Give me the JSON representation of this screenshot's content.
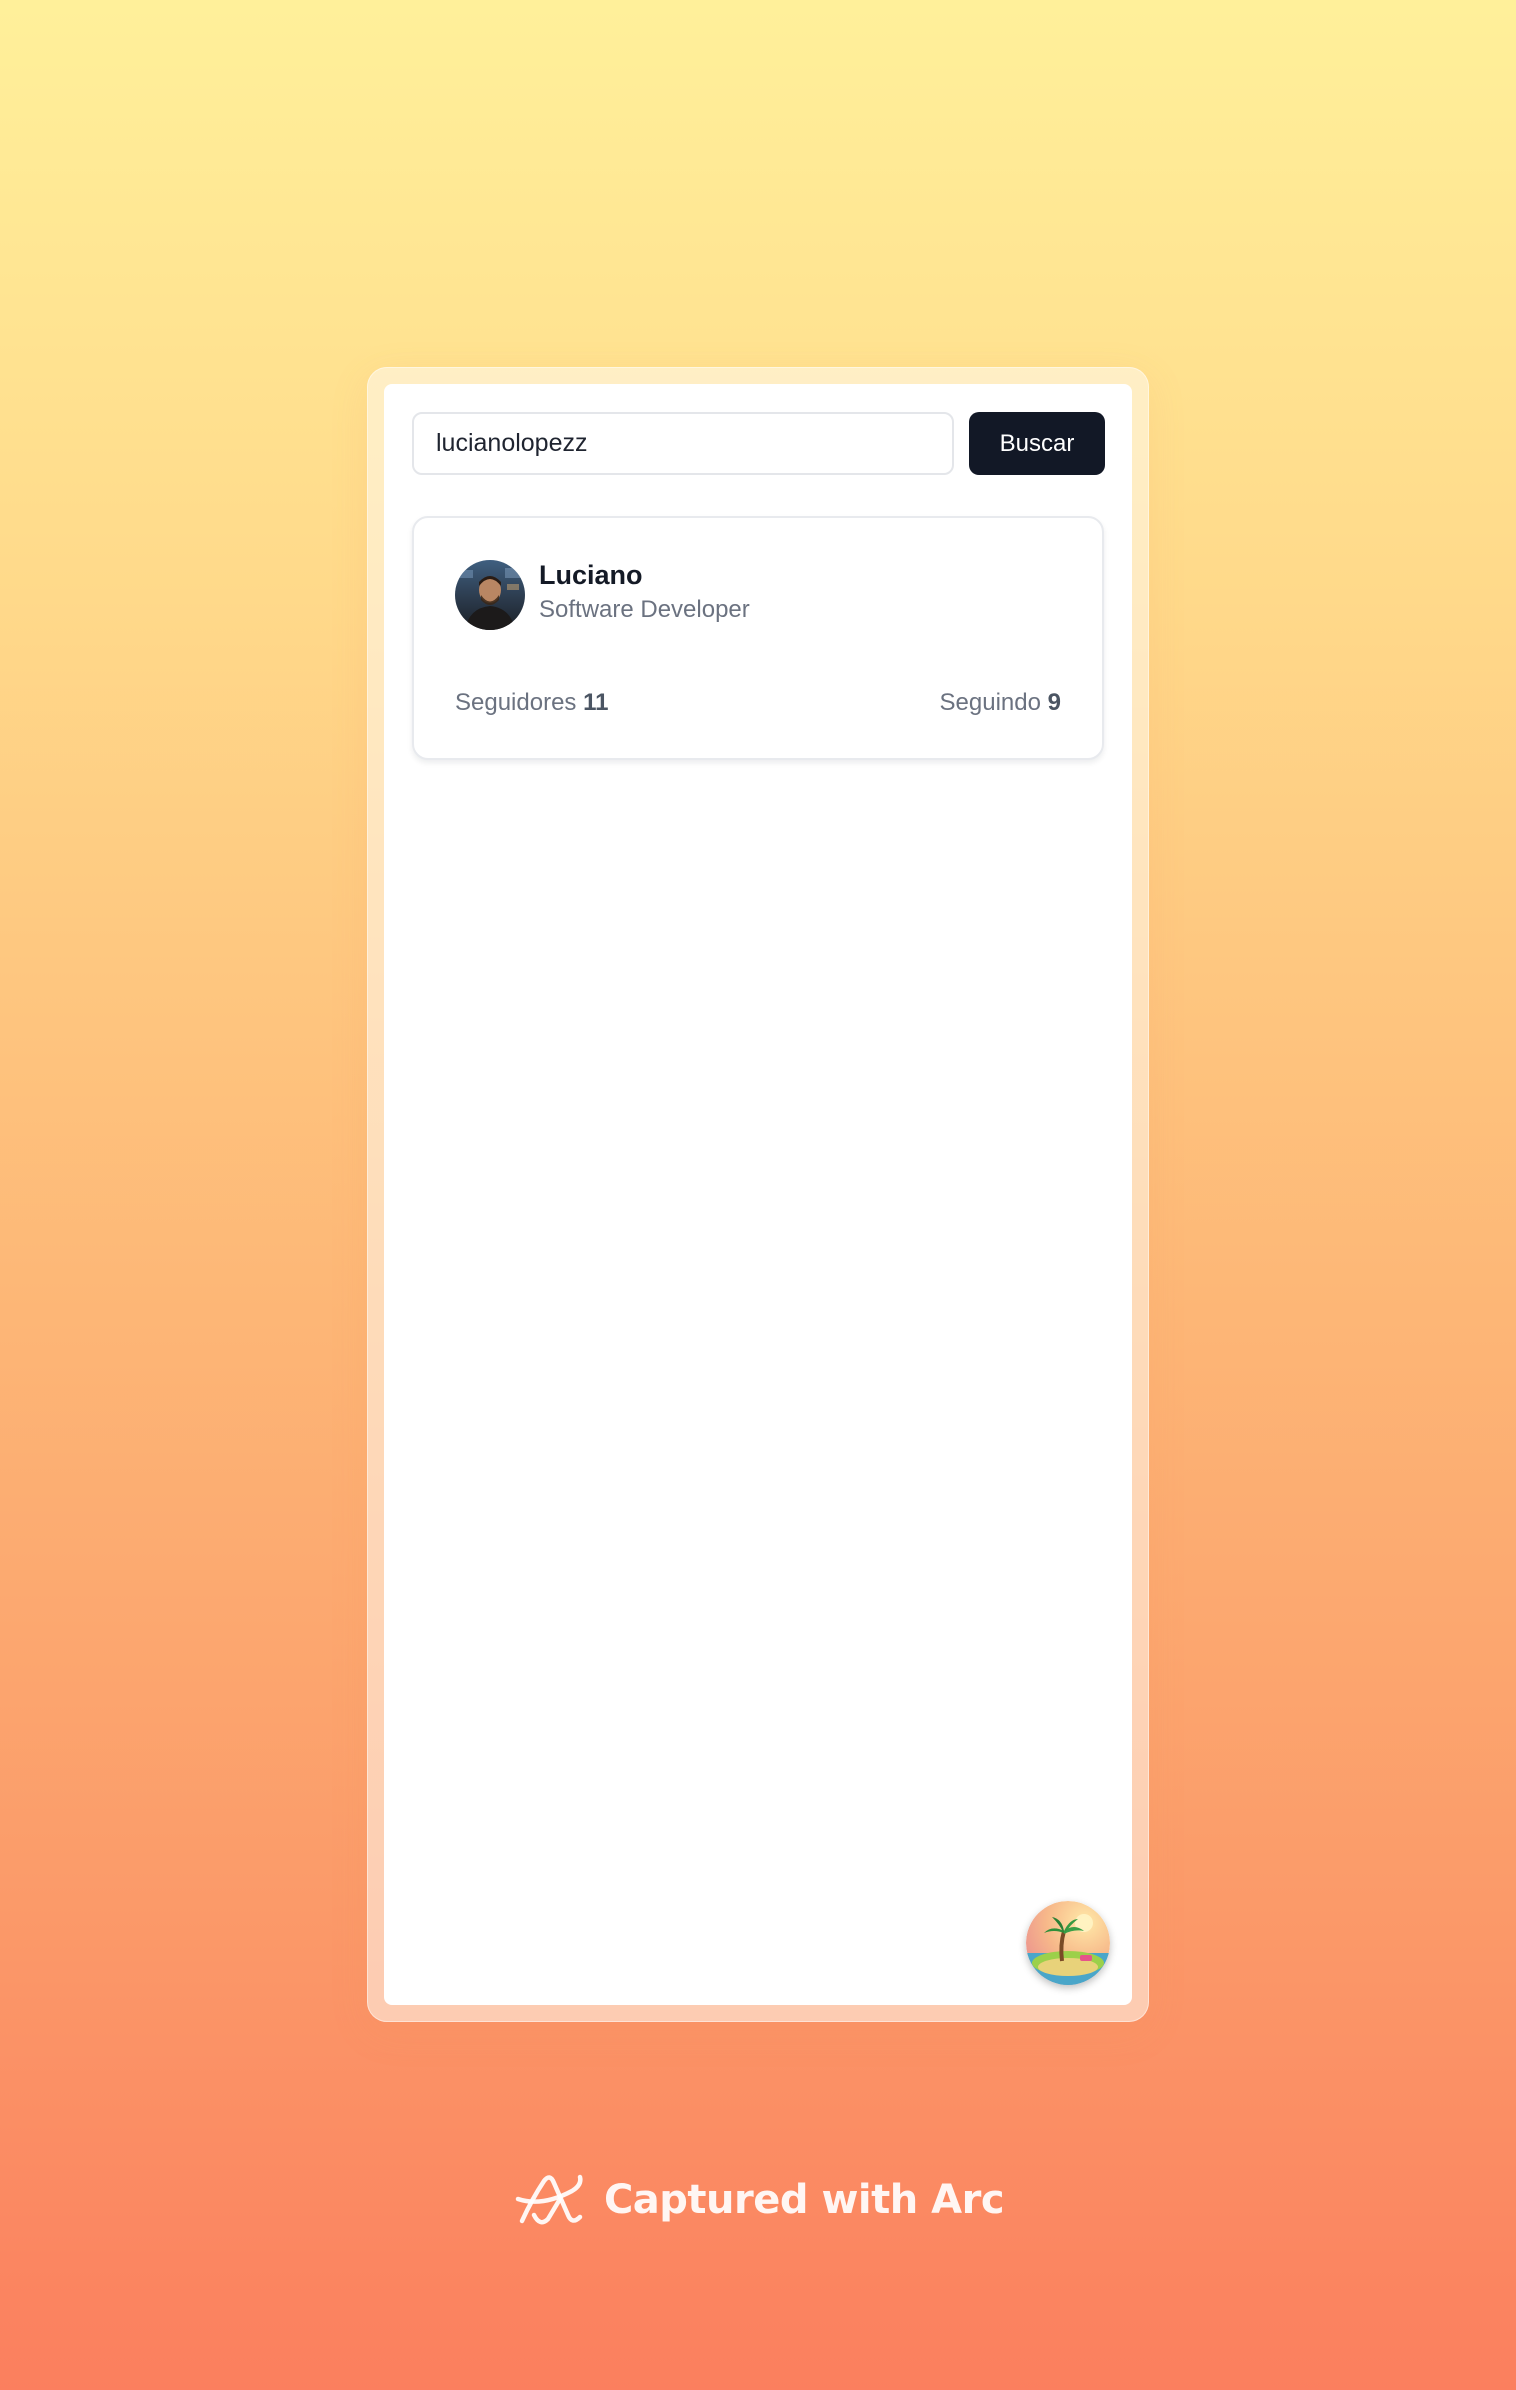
{
  "search": {
    "value": "lucianolopezz",
    "button_label": "Buscar"
  },
  "profile": {
    "name": "Luciano",
    "role": "Software Developer",
    "followers_label": "Seguidores",
    "followers_count": "11",
    "following_label": "Seguindo",
    "following_count": "9"
  },
  "fab": {
    "icon": "island-icon"
  },
  "footer": {
    "text": "Captured with Arc",
    "icon": "arc-logo-icon"
  },
  "colors": {
    "button_bg": "#121826",
    "text_primary": "#141a26",
    "text_muted": "#6b7280",
    "background_top": "#fff09a",
    "background_bottom": "#fb7f5e"
  }
}
